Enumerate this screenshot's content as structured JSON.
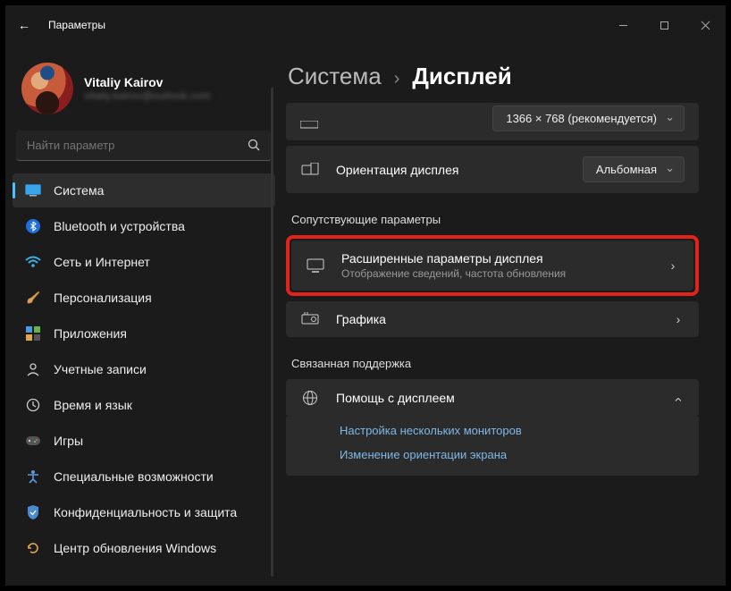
{
  "window": {
    "title": "Параметры"
  },
  "user": {
    "name": "Vitaliy Kairov",
    "email": "vitaliy.kairov@outlook.com"
  },
  "search": {
    "placeholder": "Найти параметр"
  },
  "sidebar": {
    "items": [
      {
        "label": "Система"
      },
      {
        "label": "Bluetooth и устройства"
      },
      {
        "label": "Сеть и Интернет"
      },
      {
        "label": "Персонализация"
      },
      {
        "label": "Приложения"
      },
      {
        "label": "Учетные записи"
      },
      {
        "label": "Время и язык"
      },
      {
        "label": "Игры"
      },
      {
        "label": "Специальные возможности"
      },
      {
        "label": "Конфиденциальность и защита"
      },
      {
        "label": "Центр обновления Windows"
      }
    ]
  },
  "breadcrumb": {
    "parent": "Система",
    "sep": "›",
    "current": "Дисплей"
  },
  "resolution": {
    "value": "1366 × 768 (рекомендуется)"
  },
  "orientation": {
    "label": "Ориентация дисплея",
    "value": "Альбомная"
  },
  "sections": {
    "related": "Сопутствующие параметры",
    "support": "Связанная поддержка"
  },
  "advanced": {
    "title": "Расширенные параметры дисплея",
    "sub": "Отображение сведений, частота обновления"
  },
  "graphics": {
    "title": "Графика"
  },
  "help": {
    "title": "Помощь с дисплеем",
    "links": [
      "Настройка нескольких мониторов",
      "Изменение ориентации экрана"
    ]
  }
}
